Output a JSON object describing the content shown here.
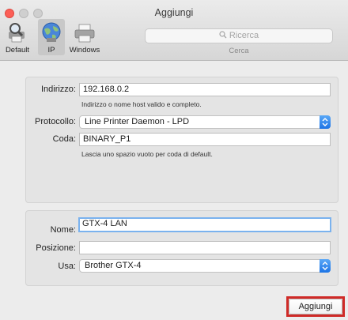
{
  "window": {
    "title": "Aggiungi"
  },
  "toolbar": {
    "items": [
      {
        "label": "Default"
      },
      {
        "label": "IP"
      },
      {
        "label": "Windows"
      }
    ]
  },
  "search": {
    "placeholder": "Ricerca",
    "caption": "Cerca"
  },
  "address": {
    "label": "Indirizzo:",
    "value": "192.168.0.2",
    "hint": "Indirizzo o nome host valido e completo."
  },
  "protocol": {
    "label": "Protocollo:",
    "value": "Line Printer Daemon - LPD"
  },
  "queue": {
    "label": "Coda:",
    "value": "BINARY_P1",
    "hint": "Lascia uno spazio vuoto per coda di default."
  },
  "name": {
    "label": "Nome:",
    "value": "GTX-4 LAN"
  },
  "location": {
    "label": "Posizione:",
    "value": ""
  },
  "use": {
    "label": "Usa:",
    "value": "Brother GTX-4"
  },
  "actions": {
    "add_label": "Aggiungi"
  },
  "colors": {
    "accent": "#1d74e6",
    "highlight_frame": "#cf2a27",
    "focus_ring": "#7ab2ee"
  }
}
